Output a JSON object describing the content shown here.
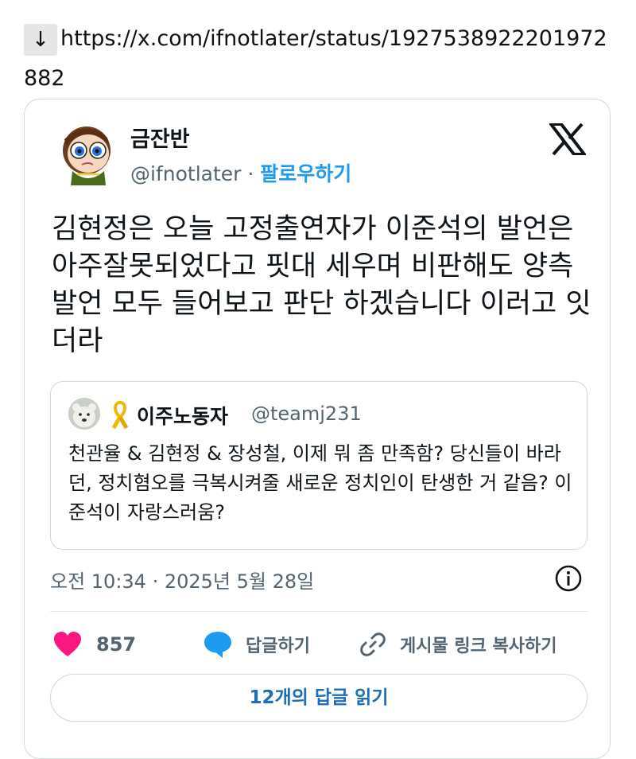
{
  "link": {
    "arrow": "↓",
    "url": "https://x.com/ifnotlater/status/1927538922201972882"
  },
  "author": {
    "name": "금잔반",
    "handle": "@ifnotlater",
    "separator": "·",
    "follow_label": "팔로우하기"
  },
  "tweet": {
    "text": "김현정은 오늘 고정출연자가 이준석의 발언은 아주잘못되었다고 핏대 세우며 비판해도 양측 발언 모두 들어보고 판단 하겠습니다 이러고 잇더라"
  },
  "quote": {
    "name": "이주노동자",
    "handle": "@teamj231",
    "text": "천관율 & 김현정 & 장성철, 이제 뭐 좀 만족함? 당신들이 바라던, 정치혐오를 극복시켜줄 새로운 정치인이 탄생한 거 같음? 이준석이 자랑스러움?"
  },
  "meta": {
    "timestamp": "오전 10:34 · 2025년 5월 28일"
  },
  "actions": {
    "likes": "857",
    "reply_label": "답글하기",
    "copy_link_label": "게시물 링크 복사하기"
  },
  "read_replies_label": "12개의 답글 읽기",
  "colors": {
    "accent": "#1d9bf0",
    "like": "#f91880",
    "muted": "#536471"
  }
}
